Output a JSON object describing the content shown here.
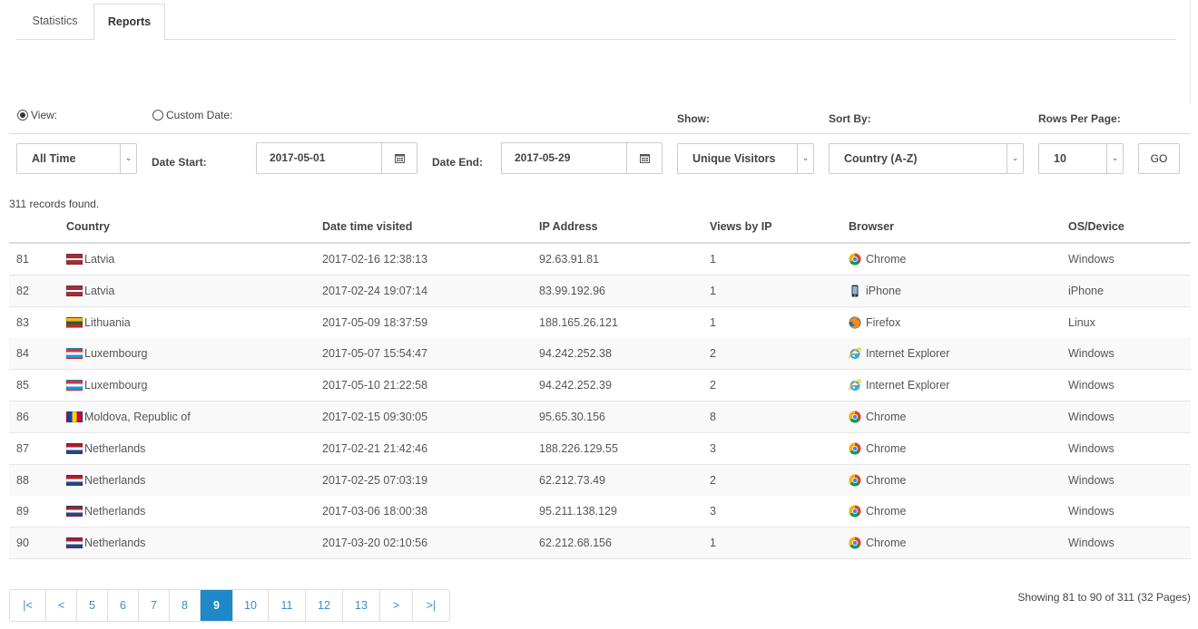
{
  "tabs": [
    {
      "label": "Statistics"
    },
    {
      "label": "Reports"
    }
  ],
  "filters": {
    "view_label": "View:",
    "custom_date_label": "Custom Date:",
    "show_label": "Show:",
    "sort_by_label": "Sort By:",
    "rows_per_page_label": "Rows Per Page:",
    "range_value": "All Time",
    "date_start_label": "Date Start:",
    "date_start_value": "2017-05-01",
    "date_end_label": "Date End:",
    "date_end_value": "2017-05-29",
    "show_value": "Unique Visitors",
    "sort_value": "Country (A-Z)",
    "rows_value": "10",
    "go_label": "GO"
  },
  "records_found": "311 records found.",
  "table": {
    "headers": [
      "Country",
      "Date time visited",
      "IP Address",
      "Views by IP",
      "Browser",
      "OS/Device"
    ],
    "rows": [
      {
        "num": "81",
        "country": "Latvia",
        "flag": "latvia-flag",
        "datetime": "2017-02-16 12:38:13",
        "ip": "92.63.91.81",
        "views": "1",
        "browser": "Chrome",
        "browser_icon": "chrome-icon",
        "os": "Windows"
      },
      {
        "num": "82",
        "country": "Latvia",
        "flag": "latvia-flag",
        "datetime": "2017-02-24 19:07:14",
        "ip": "83.99.192.96",
        "views": "1",
        "browser": "iPhone",
        "browser_icon": "iphone-icon",
        "os": "iPhone"
      },
      {
        "num": "83",
        "country": "Lithuania",
        "flag": "lithuania-flag",
        "datetime": "2017-05-09 18:37:59",
        "ip": "188.165.26.121",
        "views": "1",
        "browser": "Firefox",
        "browser_icon": "firefox-icon",
        "os": "Linux"
      },
      {
        "num": "84",
        "country": "Luxembourg",
        "flag": "luxembourg-flag",
        "datetime": "2017-05-07 15:54:47",
        "ip": "94.242.252.38",
        "views": "2",
        "browser": "Internet Explorer",
        "browser_icon": "internet-explorer-icon",
        "os": "Windows"
      },
      {
        "num": "85",
        "country": "Luxembourg",
        "flag": "luxembourg-flag",
        "datetime": "2017-05-10 21:22:58",
        "ip": "94.242.252.39",
        "views": "2",
        "browser": "Internet Explorer",
        "browser_icon": "internet-explorer-icon",
        "os": "Windows"
      },
      {
        "num": "86",
        "country": "Moldova, Republic of",
        "flag": "moldova-flag",
        "datetime": "2017-02-15 09:30:05",
        "ip": "95.65.30.156",
        "views": "8",
        "browser": "Chrome",
        "browser_icon": "chrome-icon",
        "os": "Windows"
      },
      {
        "num": "87",
        "country": "Netherlands",
        "flag": "netherlands-flag",
        "datetime": "2017-02-21 21:42:46",
        "ip": "188.226.129.55",
        "views": "3",
        "browser": "Chrome",
        "browser_icon": "chrome-icon",
        "os": "Windows"
      },
      {
        "num": "88",
        "country": "Netherlands",
        "flag": "netherlands-flag",
        "datetime": "2017-02-25 07:03:19",
        "ip": "62.212.73.49",
        "views": "2",
        "browser": "Chrome",
        "browser_icon": "chrome-icon",
        "os": "Windows"
      },
      {
        "num": "89",
        "country": "Netherlands",
        "flag": "netherlands-flag",
        "datetime": "2017-03-06 18:00:38",
        "ip": "95.211.138.129",
        "views": "3",
        "browser": "Chrome",
        "browser_icon": "chrome-icon",
        "os": "Windows"
      },
      {
        "num": "90",
        "country": "Netherlands",
        "flag": "netherlands-flag",
        "datetime": "2017-03-20 02:10:56",
        "ip": "62.212.68.156",
        "views": "1",
        "browser": "Chrome",
        "browser_icon": "chrome-icon",
        "os": "Windows"
      }
    ]
  },
  "pagination": {
    "items": [
      "|<",
      "<",
      "5",
      "6",
      "7",
      "8",
      "9",
      "10",
      "11",
      "12",
      "13",
      ">",
      ">|"
    ],
    "active": "9",
    "showing": "Showing 81 to 90 of 311 (32 Pages)"
  },
  "colors": {
    "accent": "#1e88c8",
    "link": "#3a8ec5"
  }
}
